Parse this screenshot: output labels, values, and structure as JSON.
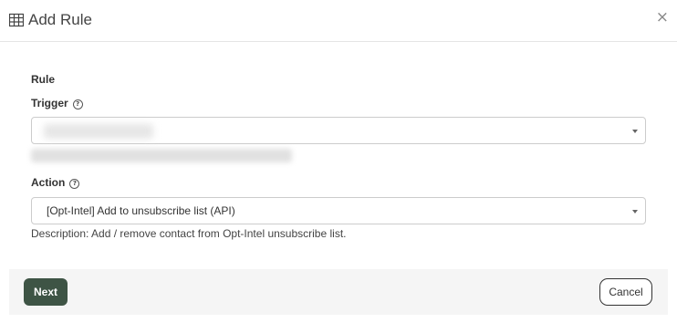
{
  "dialog": {
    "title": "Add Rule",
    "title_icon": "table-icon",
    "close_label": "×"
  },
  "form": {
    "rule_label": "Rule",
    "trigger": {
      "label": "Trigger",
      "help": "?",
      "value": "",
      "description": ""
    },
    "action": {
      "label": "Action",
      "help": "?",
      "value": "[Opt-Intel] Add to unsubscribe list (API)",
      "description": "Description: Add / remove contact from Opt-Intel unsubscribe list."
    }
  },
  "footer": {
    "next_label": "Next",
    "cancel_label": "Cancel"
  },
  "colors": {
    "primary_button": "#3e5445",
    "footer_bg": "#f5f5f5"
  }
}
